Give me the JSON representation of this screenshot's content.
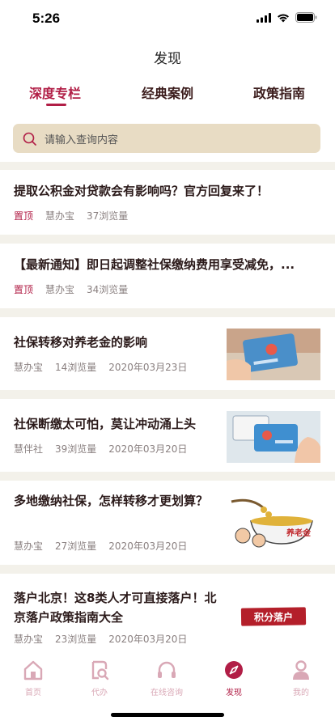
{
  "status": {
    "time": "5:26"
  },
  "page": {
    "title": "发现"
  },
  "tabs": [
    {
      "label": "深度专栏",
      "active": true
    },
    {
      "label": "经典案例",
      "active": false
    },
    {
      "label": "政策指南",
      "active": false
    }
  ],
  "search": {
    "placeholder": "请输入查询内容"
  },
  "articles": [
    {
      "title": "提取公积金对贷款会有影响吗？官方回复来了！",
      "tag": "置顶",
      "source": "慧办宝",
      "views": "37浏览量"
    },
    {
      "title": "【最新通知】即日起调整社保缴纳费用享受减免，...",
      "tag": "置顶",
      "source": "慧办宝",
      "views": "34浏览量"
    },
    {
      "title": "社保转移对养老金的影响",
      "source": "慧办宝",
      "views": "14浏览量",
      "date": "2020年03月23日",
      "thumb_icon": "social-security-card-image"
    },
    {
      "title": "社保断缴太可怕，莫让冲动涌上头",
      "source": "慧伴社",
      "views": "39浏览量",
      "date": "2020年03月20日",
      "thumb_icon": "social-security-card-image"
    },
    {
      "title": "多地缴纳社保，怎样转移才更划算？",
      "source": "慧办宝",
      "views": "27浏览量",
      "date": "2020年03月20日",
      "thumb_icon": "pension-cartoon-image",
      "thumb_text": "养老金"
    },
    {
      "title": "落户北京！这8类人才可直接落户！北京落户政策指南大全",
      "source": "慧办宝",
      "views": "23浏览量",
      "date": "2020年03月20日",
      "thumb_icon": "stamp-image",
      "thumb_text": "积分落户"
    }
  ],
  "tabbar": [
    {
      "label": "首页",
      "icon": "home-icon",
      "active": false
    },
    {
      "label": "代办",
      "icon": "search-doc-icon",
      "active": false
    },
    {
      "label": "在线咨询",
      "icon": "headset-icon",
      "active": false
    },
    {
      "label": "发现",
      "icon": "compass-icon",
      "active": true
    },
    {
      "label": "我的",
      "icon": "user-icon",
      "active": false
    }
  ],
  "colors": {
    "accent": "#b11e46",
    "search_bg": "#e8dcc4",
    "page_bg": "#f3f1ea",
    "inactive_icon": "#d9a8b6"
  }
}
